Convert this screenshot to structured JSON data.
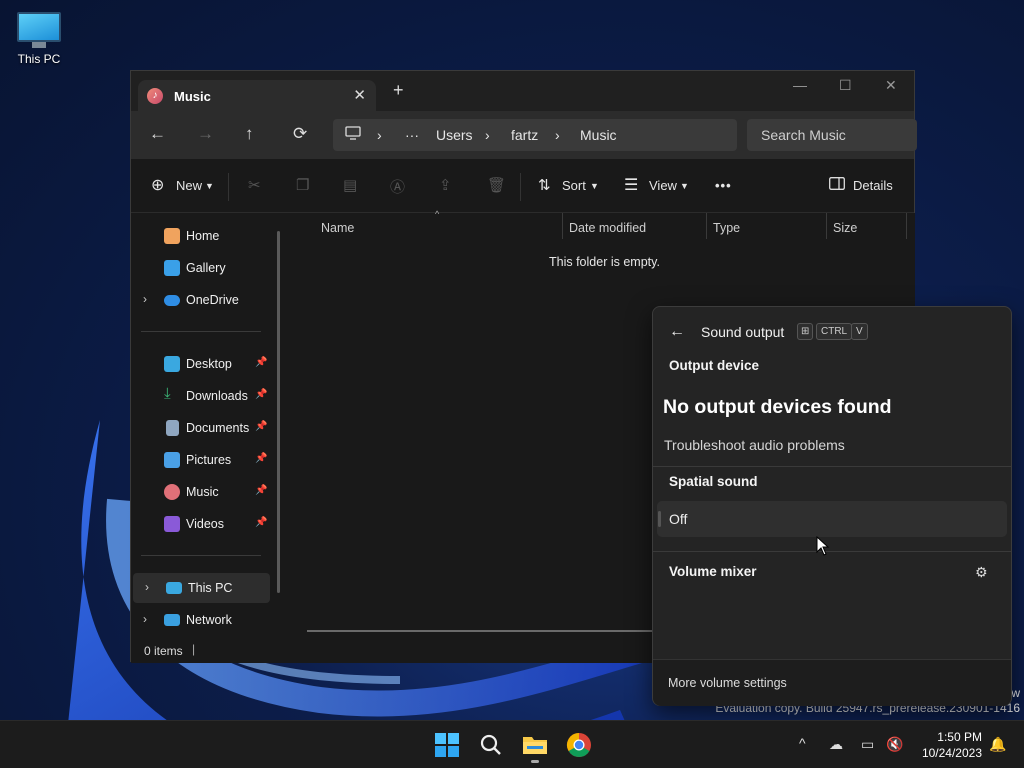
{
  "desktop": {
    "icon_label": "This PC"
  },
  "explorer": {
    "tab_title": "Music",
    "new_tab_glyph": "+",
    "nav": {
      "back": "←",
      "forward": "→",
      "up": "↑",
      "refresh": "⟳"
    },
    "breadcrumb": {
      "more": "···",
      "parts": [
        "Users",
        "fartz",
        "Music"
      ],
      "separator": "›"
    },
    "search_placeholder": "Search Music",
    "commands": {
      "new": "New",
      "sort": "Sort",
      "view": "View",
      "more": "•••",
      "details": "Details"
    },
    "sidebar": {
      "items": [
        {
          "label": "Home",
          "icon": "home-icon",
          "color": "#f0a35e"
        },
        {
          "label": "Gallery",
          "icon": "gallery-icon",
          "color": "#3aa0e8"
        },
        {
          "label": "OneDrive",
          "icon": "onedrive-icon",
          "color": "#2f8de4"
        },
        {
          "label": "Desktop",
          "icon": "desktop-icon",
          "color": "#3aa8e0"
        },
        {
          "label": "Downloads",
          "icon": "downloads-icon",
          "color": "#3cb878"
        },
        {
          "label": "Documents",
          "icon": "documents-icon",
          "color": "#8fa6c0"
        },
        {
          "label": "Pictures",
          "icon": "pictures-icon",
          "color": "#4aa0e6"
        },
        {
          "label": "Music",
          "icon": "music-icon",
          "color": "#e07078"
        },
        {
          "label": "Videos",
          "icon": "videos-icon",
          "color": "#8a5ad8"
        },
        {
          "label": "This PC",
          "icon": "this-pc-icon",
          "color": "#3aa8e0"
        },
        {
          "label": "Network",
          "icon": "network-icon",
          "color": "#3aa0e0"
        }
      ]
    },
    "columns": [
      "Name",
      "Date modified",
      "Type",
      "Size"
    ],
    "empty_message": "This folder is empty.",
    "status": "0 items"
  },
  "sound_flyout": {
    "title": "Sound output",
    "shortcut_keys": [
      "CTRL",
      "V"
    ],
    "output_device_heading": "Output device",
    "no_devices": "No output devices found",
    "troubleshoot_link": "Troubleshoot audio problems",
    "spatial_heading": "Spatial sound",
    "spatial_value": "Off",
    "mixer_heading": "Volume mixer",
    "footer_link": "More volume settings"
  },
  "watermark": {
    "line1": "w",
    "line2": "Evaluation copy. Build 25947.rs_prerelease.230901-1416"
  },
  "taskbar": {
    "time": "1:50 PM",
    "date": "10/24/2023"
  }
}
